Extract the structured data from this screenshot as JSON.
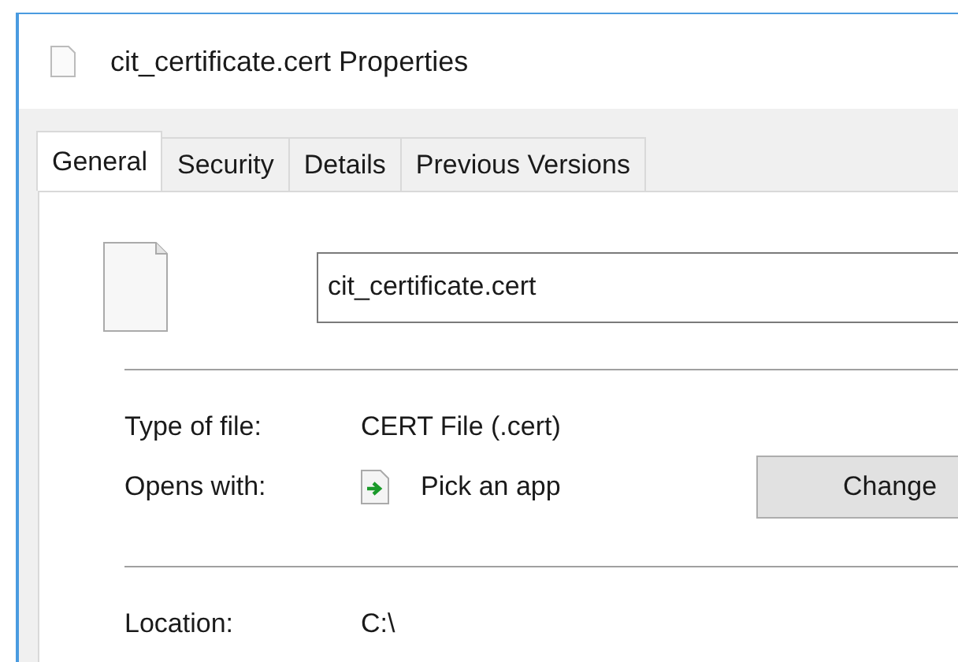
{
  "window": {
    "title": "cit_certificate.cert Properties"
  },
  "tabs": [
    {
      "label": "General",
      "selected": true
    },
    {
      "label": "Security",
      "selected": false
    },
    {
      "label": "Details",
      "selected": false
    },
    {
      "label": "Previous Versions",
      "selected": false
    }
  ],
  "file_name": {
    "value": "cit_certificate.cert"
  },
  "properties": [
    {
      "label": "Type of file:",
      "value": "CERT File (.cert)"
    },
    {
      "label": "Opens with:",
      "value": "Pick an app",
      "button": "Change"
    }
  ],
  "location": {
    "label": "Location:",
    "value": "C:\\"
  }
}
